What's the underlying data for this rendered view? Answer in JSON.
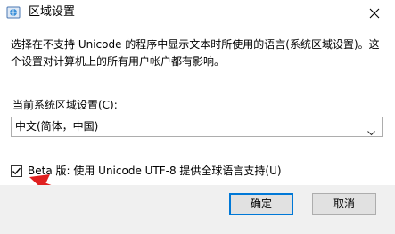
{
  "window": {
    "title": "区域设置",
    "title_icon": "globe-settings-icon",
    "close_icon": "close-icon"
  },
  "description": "选择在不支持 Unicode 的程序中显示文本时所使用的语言(系统区域设置)。这个设置对计算机上的所有用户帐户都有影响。",
  "current_locale": {
    "label": "当前系统区域设置(C):",
    "selected": "中文(简体，中国)"
  },
  "beta_option": {
    "label": "Beta 版: 使用 Unicode UTF-8 提供全球语言支持(U)",
    "checked": true
  },
  "buttons": {
    "ok": "确定",
    "cancel": "取消"
  },
  "colors": {
    "annotation_arrow": "#e02020",
    "accent": "#0078d7"
  }
}
